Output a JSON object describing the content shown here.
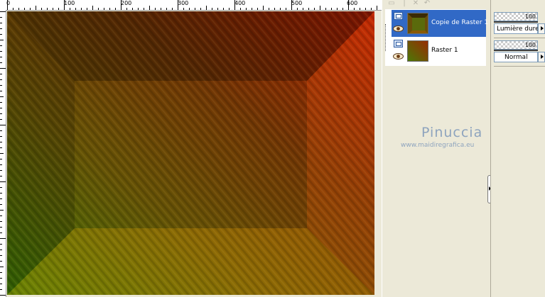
{
  "ruler": {
    "labels": [
      "0",
      "100",
      "200",
      "300",
      "400",
      "500",
      "600"
    ]
  },
  "layers": [
    {
      "name": "Copie de Raster 1",
      "selected": true
    },
    {
      "name": "Raster 1",
      "selected": false
    }
  ],
  "properties": [
    {
      "opacity": "100",
      "blend_mode": "Lumière dure"
    },
    {
      "opacity": "100",
      "blend_mode": "Normal"
    }
  ],
  "watermark": {
    "name": "Pinuccia",
    "url": "www.maidiregrafica.eu"
  },
  "colors": {
    "selection": "#3169c6",
    "panel_bg": "#ece9d8",
    "watermark": "#8ea4be"
  },
  "icons": [
    "new-layer-icon",
    "delete-layer-icon",
    "undo-icon",
    "layer-type-icon",
    "eye-icon",
    "scroll-arrow-icon",
    "dropdown-arrow-icon"
  ]
}
